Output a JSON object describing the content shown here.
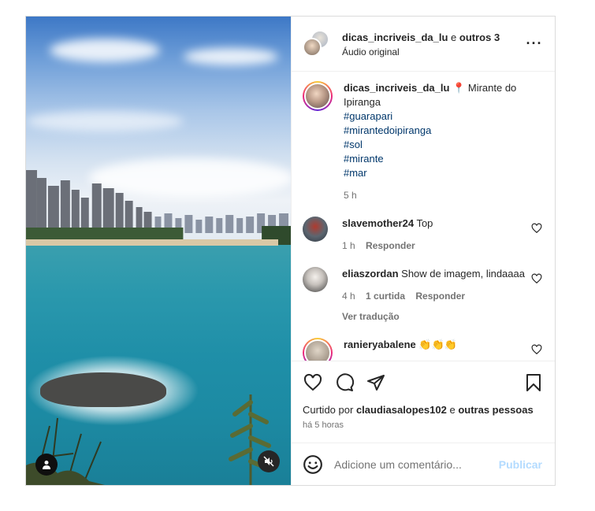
{
  "header": {
    "author": "dicas_incriveis_da_lu",
    "joiner": "e",
    "collaborators": "outros 3",
    "audio": "Áudio original",
    "more_icon": "more-horizontal-icon"
  },
  "caption": {
    "username": "dicas_incriveis_da_lu",
    "pin_icon": "round-pushpin-emoji",
    "text": "Mirante do Ipiranga",
    "hashtags": [
      "#guarapari",
      "#mirantedoipiranga",
      "#sol",
      "#mirante",
      "#mar"
    ],
    "time": "5 h"
  },
  "comments": [
    {
      "username": "slavemother24",
      "text": "Top",
      "time": "1 h",
      "likes": "",
      "reply": "Responder",
      "translate": ""
    },
    {
      "username": "eliaszordan",
      "text": "Show de imagem, lindaaaa",
      "time": "4 h",
      "likes": "1 curtida",
      "reply": "Responder",
      "translate": "Ver tradução"
    },
    {
      "username": "ranieryabalene",
      "text": "👏👏👏",
      "time": "",
      "likes": "",
      "reply": "",
      "translate": ""
    }
  ],
  "actions": {
    "icons": [
      "heart-icon",
      "comment-icon",
      "share-icon",
      "bookmark-icon"
    ],
    "liked_prefix": "Curtido por",
    "liked_user": "claudiasalopes102",
    "liked_joiner": "e",
    "liked_rest": "outras pessoas",
    "timestamp": "há 5 horas"
  },
  "comment_box": {
    "placeholder": "Adicione um comentário...",
    "publish": "Publicar",
    "emoji_icon": "emoji-icon"
  },
  "media": {
    "user_tag_icon": "user-tag-icon",
    "mute_icon": "audio-muted-icon"
  },
  "colors": {
    "link": "#00376b",
    "secondary_text": "#737373",
    "publish_disabled": "#b3dbff"
  }
}
